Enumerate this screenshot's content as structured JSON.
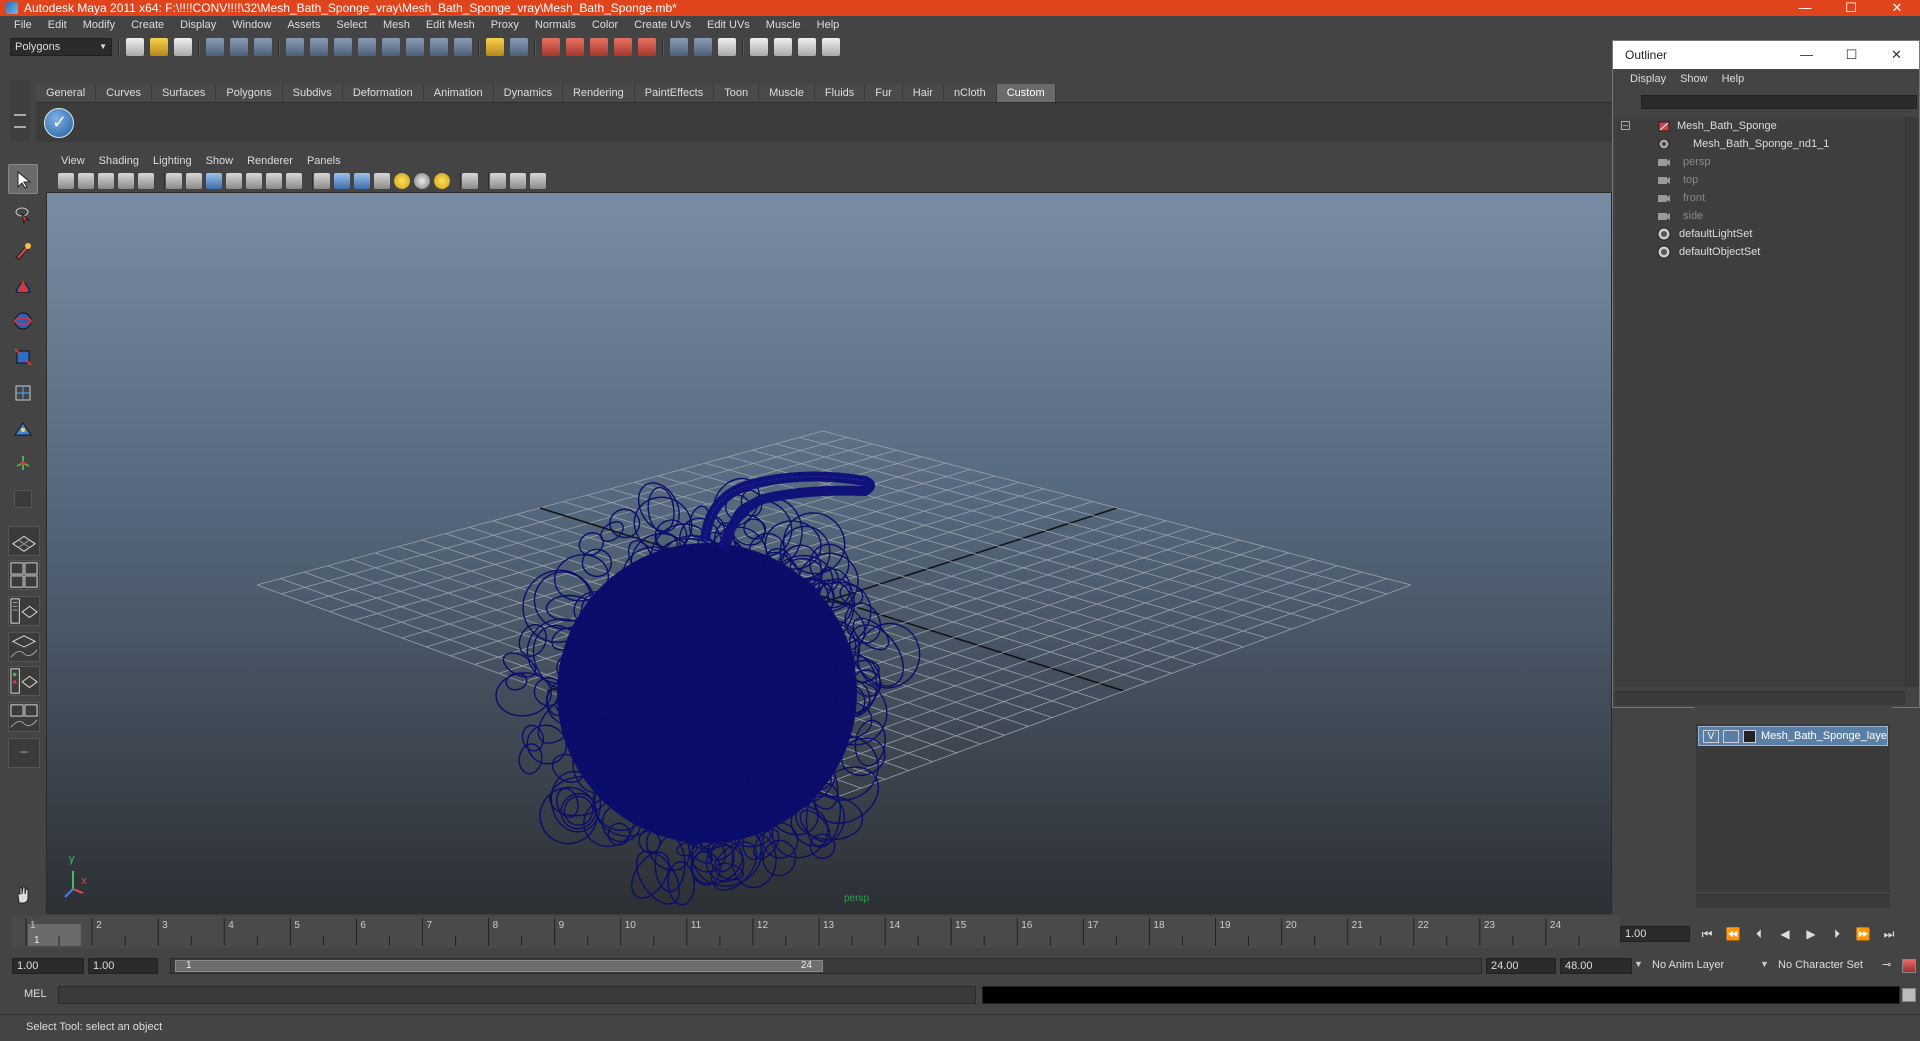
{
  "window": {
    "title": "Autodesk Maya 2011 x64: F:\\!!!!CONV!!!!\\32\\Mesh_Bath_Sponge_vray\\Mesh_Bath_Sponge_vray\\Mesh_Bath_Sponge.mb*",
    "minimize": "—",
    "maximize": "☐",
    "close": "✕"
  },
  "menubar": [
    "File",
    "Edit",
    "Modify",
    "Create",
    "Display",
    "Window",
    "Assets",
    "Select",
    "Mesh",
    "Edit Mesh",
    "Proxy",
    "Normals",
    "Color",
    "Create UVs",
    "Edit UVs",
    "Muscle",
    "Help"
  ],
  "statusline": {
    "mode": "Polygons"
  },
  "shelf": {
    "tabs": [
      "General",
      "Curves",
      "Surfaces",
      "Polygons",
      "Subdivs",
      "Deformation",
      "Animation",
      "Dynamics",
      "Rendering",
      "PaintEffects",
      "Toon",
      "Muscle",
      "Fluids",
      "Fur",
      "Hair",
      "nCloth",
      "Custom"
    ],
    "active": "Custom"
  },
  "panel": {
    "menus": [
      "View",
      "Shading",
      "Lighting",
      "Show",
      "Renderer",
      "Panels"
    ],
    "camera": "persp",
    "axis_x": "x",
    "axis_y": "y",
    "accent_wire": "#0b0d6b"
  },
  "outliner": {
    "title": "Outliner",
    "menus": [
      "Display",
      "Show",
      "Help"
    ],
    "items": [
      {
        "label": "Mesh_Bath_Sponge",
        "dim": false
      },
      {
        "label": "Mesh_Bath_Sponge_nd1_1",
        "dim": false
      },
      {
        "label": "persp",
        "dim": true
      },
      {
        "label": "top",
        "dim": true
      },
      {
        "label": "front",
        "dim": true
      },
      {
        "label": "side",
        "dim": true
      },
      {
        "label": "defaultLightSet",
        "dim": false
      },
      {
        "label": "defaultObjectSet",
        "dim": false
      }
    ]
  },
  "layers": {
    "visible": "V",
    "name": "Mesh_Bath_Sponge_layer"
  },
  "timeline": {
    "ticks": [
      1,
      2,
      3,
      4,
      5,
      6,
      7,
      8,
      9,
      10,
      11,
      12,
      13,
      14,
      15,
      16,
      17,
      18,
      19,
      20,
      21,
      22,
      23,
      24
    ],
    "current_frame": "1",
    "current_time": "1.00"
  },
  "range": {
    "start": "1.00",
    "inner_start": "1.00",
    "handle_start": "1",
    "handle_end": "24",
    "inner_end": "24.00",
    "end": "48.00",
    "anim_layer": "No Anim Layer",
    "character_set": "No Character Set"
  },
  "cmdline": {
    "label": "MEL"
  },
  "helpline": {
    "text": "Select Tool: select an object"
  },
  "playback": [
    "⏮",
    "⏪",
    "⏴",
    "◀",
    "▶",
    "⏵",
    "⏩",
    "⏭"
  ]
}
